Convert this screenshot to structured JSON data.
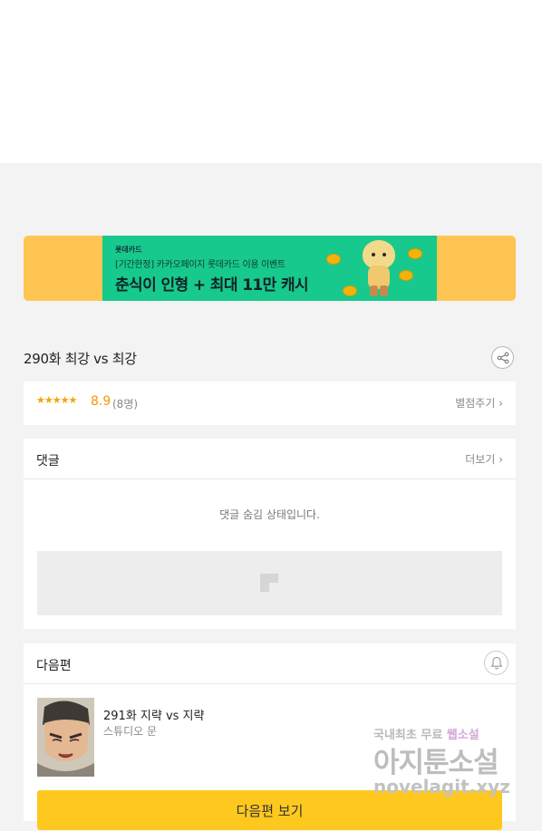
{
  "banner": {
    "brand": "롯데카드",
    "subtitle": "[기간한정] 카카오페이지 롯데카드 이용 이벤트",
    "headline": "춘식이 인형 + 최대 11만 캐시",
    "colors": {
      "outer": "#ffc552",
      "inner": "#17c98c"
    }
  },
  "episode": {
    "title": "290화 최강 vs 최강",
    "share_icon": "share-icon"
  },
  "rating": {
    "stars": "★★★★★",
    "score": "8.9",
    "count": "(8명)",
    "rate_link": "별점주기 ›",
    "star_fraction": 0.89
  },
  "comments": {
    "title": "댓글",
    "more": "더보기 ›",
    "hidden_message": "댓글 숨김 상태입니다."
  },
  "next_episode": {
    "section_title": "다음편",
    "title": "291화 지략 vs 지략",
    "author": "스튜디오 문",
    "button": "다음편 보기"
  },
  "watermark": {
    "line1_a": "국내최초 무료 ",
    "line1_b": "웹소설",
    "line2": "아지툰소설",
    "line3": "novelagit.xyz"
  }
}
